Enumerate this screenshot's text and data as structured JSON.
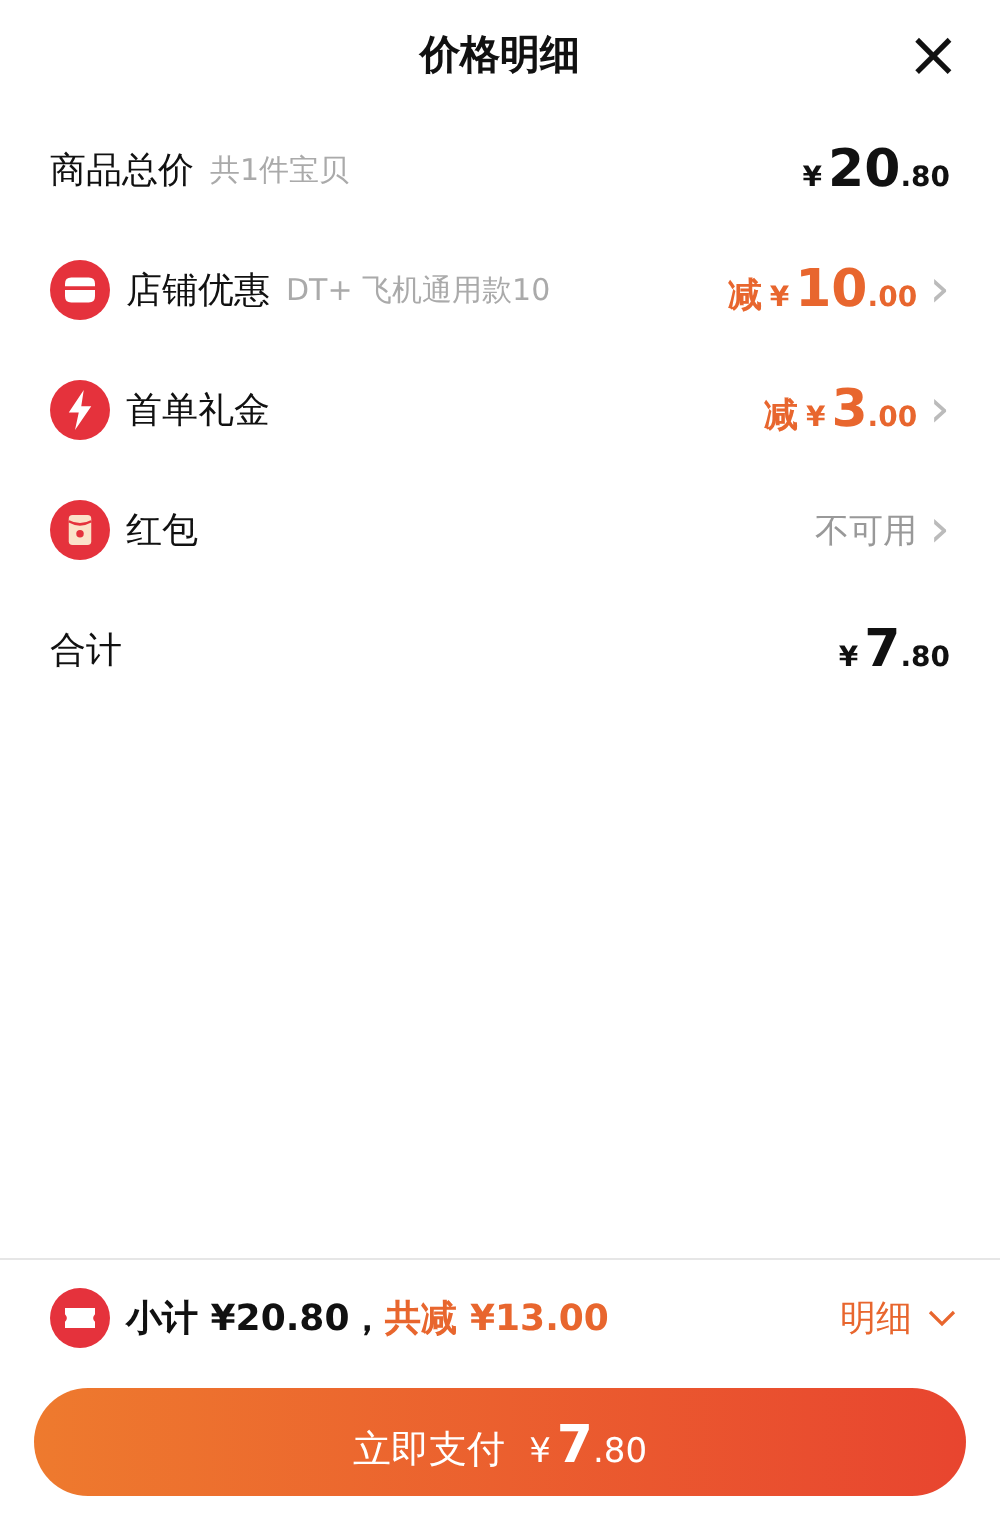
{
  "title": "价格明细",
  "close": "×",
  "goods_total": {
    "label": "商品总价",
    "note": "共1件宝贝",
    "amount": {
      "currency": "¥",
      "integer": "20",
      "decimal": ".80"
    }
  },
  "discounts": [
    {
      "kind": "amount",
      "label": "店铺优惠",
      "note": "DT+ 飞机通用款10",
      "prefix": "减",
      "amount": {
        "currency": "¥",
        "integer": "10",
        "decimal": ".00"
      },
      "chevron": "›"
    },
    {
      "kind": "amount",
      "label": "首单礼金",
      "prefix": "减",
      "amount": {
        "currency": "¥",
        "integer": "3",
        "decimal": ".00"
      },
      "chevron": "›"
    },
    {
      "kind": "status",
      "label": "红包",
      "status": "不可用",
      "chevron": "›"
    }
  ],
  "sum": {
    "label": "合计",
    "amount": {
      "currency": "¥",
      "integer": "7",
      "decimal": ".80"
    }
  },
  "footer": {
    "subtotal": "小计 ¥20.80，",
    "saved": "共减 ¥13.00",
    "details": "明细"
  },
  "pay_button": {
    "label": "立即支付",
    "amount": {
      "currency": "¥",
      "integer": "7",
      "decimal": ".80"
    }
  }
}
